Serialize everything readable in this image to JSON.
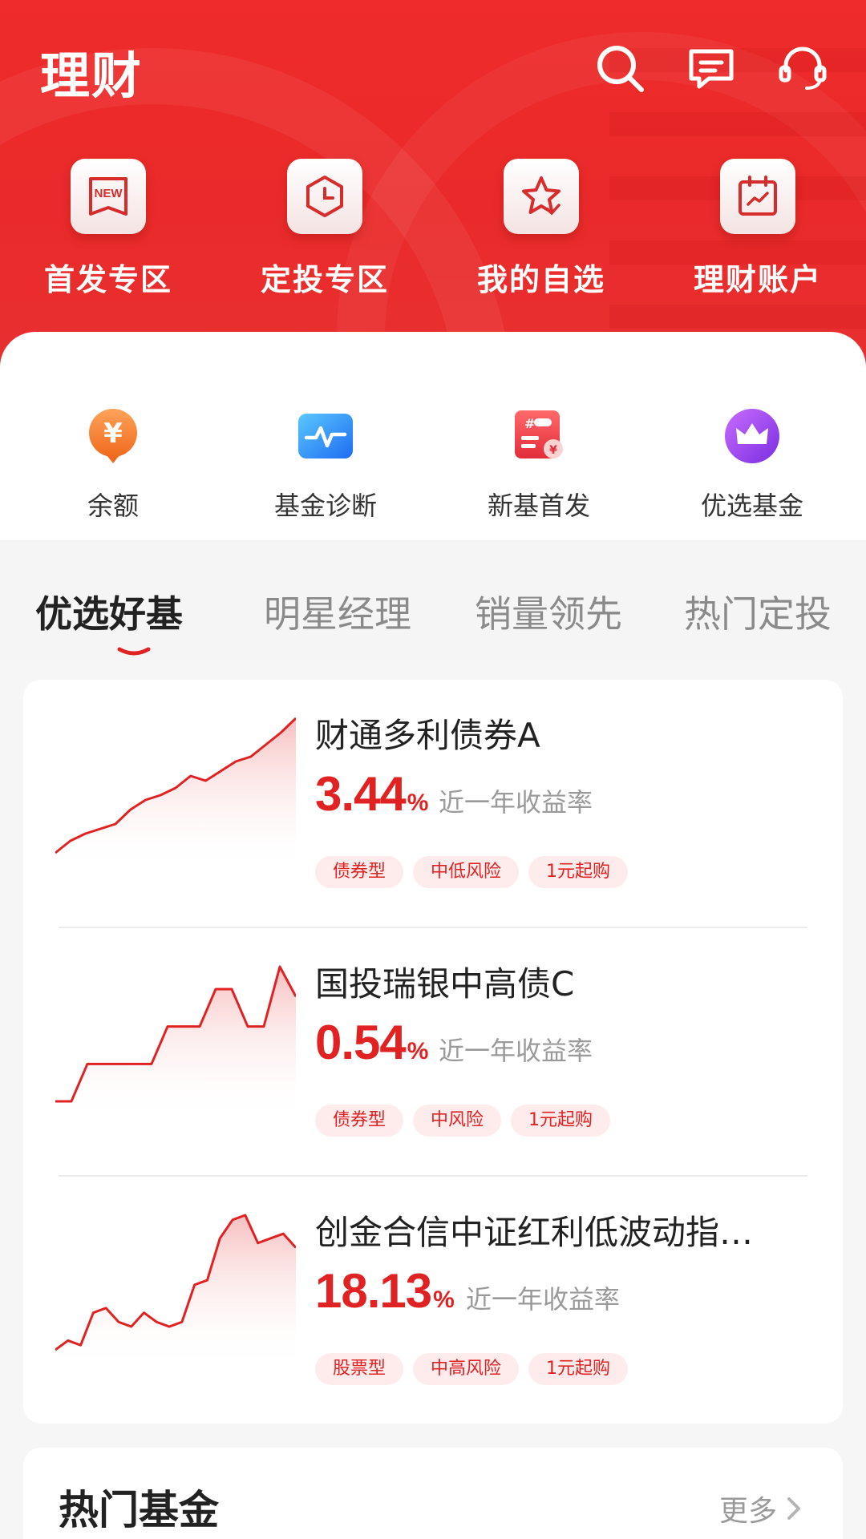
{
  "header": {
    "title": "理财",
    "icons": [
      "search-icon",
      "message-icon",
      "customer-service-icon"
    ]
  },
  "quick_entries": [
    {
      "label": "首发专区",
      "icon": "new-badge-icon"
    },
    {
      "label": "定投专区",
      "icon": "clock-icon"
    },
    {
      "label": "我的自选",
      "icon": "star-icon"
    },
    {
      "label": "理财账户",
      "icon": "calendar-chart-icon"
    }
  ],
  "services": [
    {
      "label": "余额",
      "icon": "yuan-coin-icon"
    },
    {
      "label": "基金诊断",
      "icon": "diagnosis-icon"
    },
    {
      "label": "新基首发",
      "icon": "new-fund-icon"
    },
    {
      "label": "优选基金",
      "icon": "crown-icon"
    }
  ],
  "tabs": [
    "优选好基",
    "明星经理",
    "销量领先",
    "热门定投"
  ],
  "active_tab": "优选好基",
  "funds": [
    {
      "name": "财通多利债券A",
      "rate": "3.44",
      "rate_unit": "%",
      "rate_label": "近一年收益率",
      "tags": [
        "债券型",
        "中低风险",
        "1元起购"
      ],
      "spark": [
        0,
        5,
        8,
        10,
        12,
        18,
        22,
        24,
        27,
        32,
        30,
        34,
        38,
        40,
        45,
        50,
        56
      ]
    },
    {
      "name": "国投瑞银中高债C",
      "rate": "0.54",
      "rate_unit": "%",
      "rate_label": "近一年收益率",
      "tags": [
        "债券型",
        "中风险",
        "1元起购"
      ],
      "spark": [
        0,
        0,
        5,
        5,
        5,
        5,
        5,
        10,
        10,
        10,
        15,
        15,
        10,
        10,
        18,
        14
      ]
    },
    {
      "name": "创金合信中证红利低波动指…",
      "rate": "18.13",
      "rate_unit": "%",
      "rate_label": "近一年收益率",
      "tags": [
        "股票型",
        "中高风险",
        "1元起购"
      ],
      "spark": [
        2,
        4,
        3,
        10,
        11,
        8,
        7,
        10,
        8,
        7,
        8,
        16,
        17,
        26,
        30,
        31,
        25,
        26,
        27,
        24
      ]
    }
  ],
  "hot_section": {
    "title": "热门基金",
    "more_label": "更多"
  },
  "colors": {
    "brand_red": "#e83030",
    "rate_red": "#e02222",
    "tag_bg": "#fdeceb"
  }
}
